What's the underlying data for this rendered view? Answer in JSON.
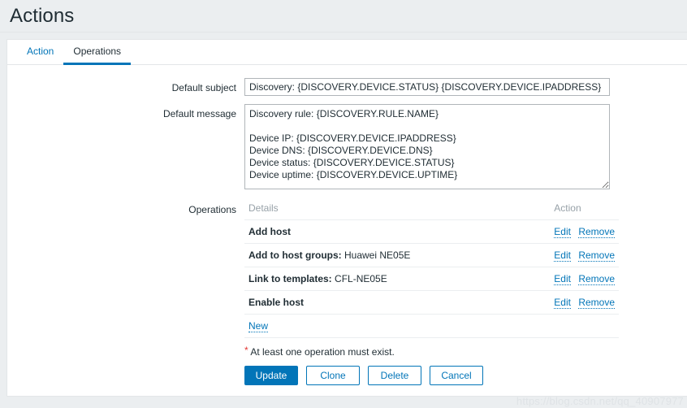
{
  "header": {
    "title": "Actions"
  },
  "tabs": [
    {
      "label": "Action",
      "selected": false
    },
    {
      "label": "Operations",
      "selected": true
    }
  ],
  "form": {
    "default_subject": {
      "label": "Default subject",
      "value": "Discovery: {DISCOVERY.DEVICE.STATUS} {DISCOVERY.DEVICE.IPADDRESS}",
      "placeholder": ""
    },
    "default_message": {
      "label": "Default message",
      "value": "Discovery rule: {DISCOVERY.RULE.NAME}\n\nDevice IP: {DISCOVERY.DEVICE.IPADDRESS}\nDevice DNS: {DISCOVERY.DEVICE.DNS}\nDevice status: {DISCOVERY.DEVICE.STATUS}\nDevice uptime: {DISCOVERY.DEVICE.UPTIME}",
      "placeholder": ""
    },
    "operations": {
      "label": "Operations",
      "columns": {
        "details": "Details",
        "action": "Action"
      },
      "rows": [
        {
          "name": "Add host",
          "value": "",
          "edit": "Edit",
          "remove": "Remove"
        },
        {
          "name": "Add to host groups:",
          "value": "Huawei NE05E",
          "edit": "Edit",
          "remove": "Remove"
        },
        {
          "name": "Link to templates:",
          "value": "CFL-NE05E",
          "edit": "Edit",
          "remove": "Remove"
        },
        {
          "name": "Enable host",
          "value": "",
          "edit": "Edit",
          "remove": "Remove"
        }
      ],
      "new_link": "New"
    }
  },
  "footer": {
    "required_marker": "*",
    "note": "At least one operation must exist.",
    "buttons": [
      {
        "label": "Update",
        "primary": true
      },
      {
        "label": "Clone",
        "primary": false
      },
      {
        "label": "Delete",
        "primary": false
      },
      {
        "label": "Cancel",
        "primary": false
      }
    ]
  },
  "watermark": {
    "text": "https://blog.csdn.net/qq_40907977"
  },
  "colors": {
    "accent": "#0275b8",
    "page_bg": "#ebeef0",
    "panel_bg": "#ffffff",
    "text": "#1f2c33",
    "muted": "#97a1a8",
    "required": "#e33734"
  }
}
